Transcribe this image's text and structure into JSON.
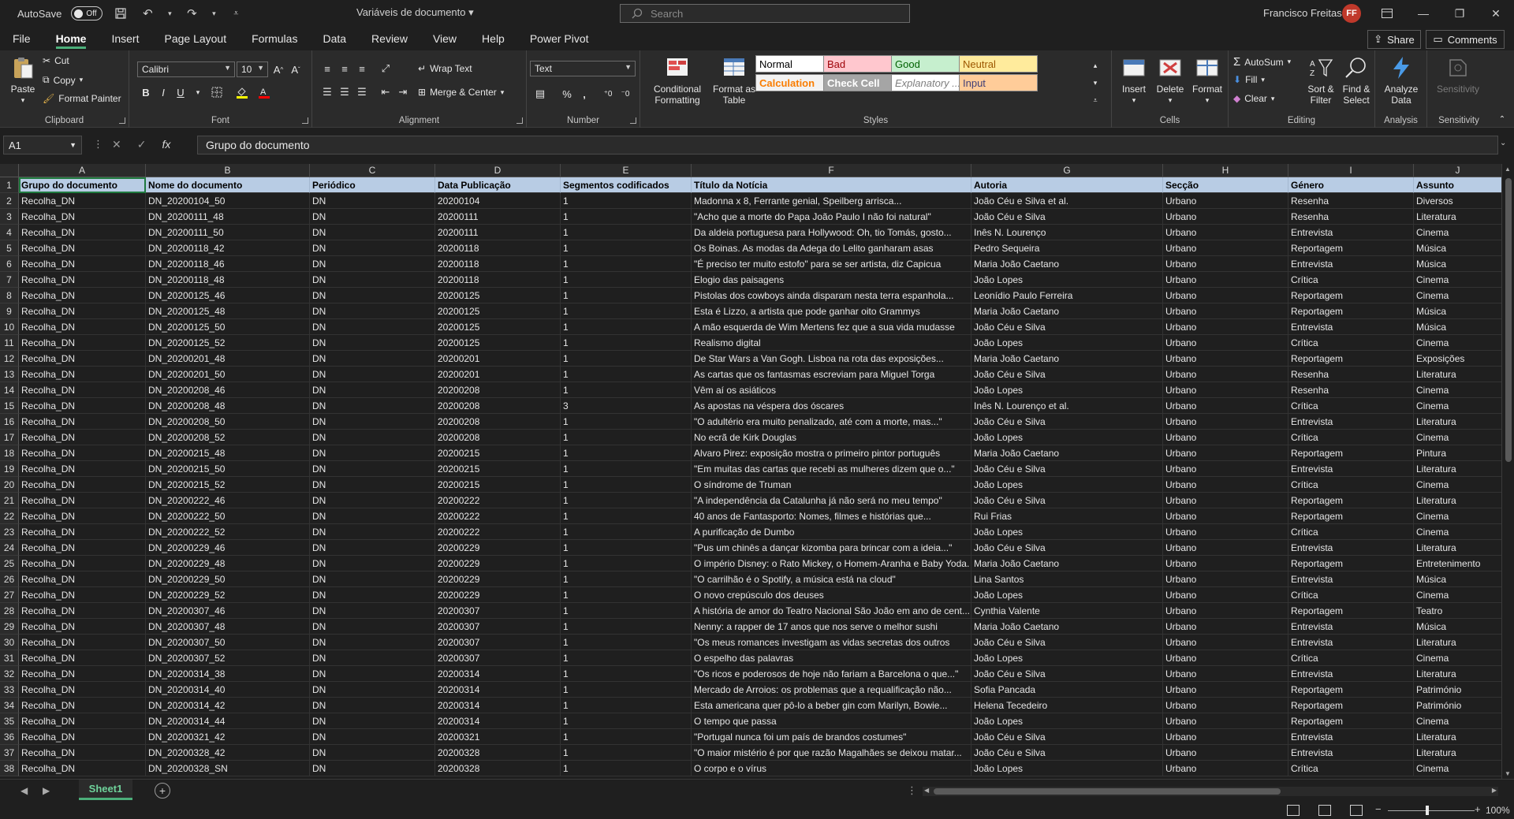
{
  "titlebar": {
    "autosave_label": "AutoSave",
    "autosave_state": "Off",
    "document_title": "Variáveis de documento",
    "search_placeholder": "Search",
    "user_name": "Francisco Freitas",
    "user_initials": "FF"
  },
  "menu": {
    "tabs": [
      "File",
      "Home",
      "Insert",
      "Page Layout",
      "Formulas",
      "Data",
      "Review",
      "View",
      "Help",
      "Power Pivot"
    ],
    "active": "Home",
    "share_label": "Share",
    "comments_label": "Comments"
  },
  "ribbon": {
    "clipboard": {
      "label": "Clipboard",
      "paste": "Paste",
      "cut": "Cut",
      "copy": "Copy",
      "format_painter": "Format Painter"
    },
    "font": {
      "label": "Font",
      "font_name": "Calibri",
      "font_size": "10",
      "bold": "B",
      "italic": "I",
      "underline": "U"
    },
    "alignment": {
      "label": "Alignment",
      "wrap_text": "Wrap Text",
      "merge_center": "Merge & Center"
    },
    "number": {
      "label": "Number",
      "format": "Text"
    },
    "styles": {
      "label": "Styles",
      "conditional_formatting": "Conditional Formatting",
      "format_as_table": "Format as Table",
      "cells": [
        {
          "name": "Normal",
          "bg": "#ffffff",
          "fg": "#000000"
        },
        {
          "name": "Bad",
          "bg": "#ffc7ce",
          "fg": "#9c0006"
        },
        {
          "name": "Good",
          "bg": "#c6efce",
          "fg": "#006100"
        },
        {
          "name": "Neutral",
          "bg": "#ffeb9c",
          "fg": "#9c5700"
        },
        {
          "name": "Calculation",
          "bg": "#f2f2f2",
          "fg": "#fa7d00"
        },
        {
          "name": "Check Cell",
          "bg": "#a5a5a5",
          "fg": "#ffffff"
        },
        {
          "name": "Explanatory ...",
          "bg": "#ffffff",
          "fg": "#7f7f7f"
        },
        {
          "name": "Input",
          "bg": "#ffcc99",
          "fg": "#3f3f76"
        }
      ]
    },
    "cells_group": {
      "label": "Cells",
      "insert": "Insert",
      "delete": "Delete",
      "format": "Format"
    },
    "editing": {
      "label": "Editing",
      "autosum": "AutoSum",
      "fill": "Fill",
      "clear": "Clear",
      "sort_filter": "Sort & Filter",
      "find_select": "Find & Select"
    },
    "analysis": {
      "label": "Analysis",
      "analyze_data": "Analyze Data"
    },
    "sensitivity": {
      "label": "Sensitivity",
      "sensitivity": "Sensitivity"
    }
  },
  "formula_bar": {
    "name_box": "A1",
    "value": "Grupo do documento"
  },
  "sheet": {
    "columns": [
      "A",
      "B",
      "C",
      "D",
      "E",
      "F",
      "G",
      "H",
      "I",
      "J"
    ],
    "header_row": [
      "Grupo do documento",
      "Nome do documento",
      "Periódico",
      "Data Publicação",
      "Segmentos codificados",
      "Título da Notícia",
      "Autoria",
      "Secção",
      "Género",
      "Assunto"
    ],
    "rows": [
      [
        "Recolha_DN",
        "DN_20200104_50",
        "DN",
        "20200104",
        "1",
        "Madonna x 8, Ferrante genial, Speilberg arrisca...",
        "João Céu e Silva et al.",
        "Urbano",
        "Resenha",
        "Diversos"
      ],
      [
        "Recolha_DN",
        "DN_20200111_48",
        "DN",
        "20200111",
        "1",
        "\"Acho que a morte do Papa João Paulo I não foi natural\"",
        "João Céu e Silva",
        "Urbano",
        "Resenha",
        "Literatura"
      ],
      [
        "Recolha_DN",
        "DN_20200111_50",
        "DN",
        "20200111",
        "1",
        "Da aldeia portuguesa para Hollywood: Oh, tio Tomás, gosto...",
        "Inês N. Lourenço",
        "Urbano",
        "Entrevista",
        "Cinema"
      ],
      [
        "Recolha_DN",
        "DN_20200118_42",
        "DN",
        "20200118",
        "1",
        "Os Boinas. As modas da Adega do Lelito ganharam asas",
        "Pedro Sequeira",
        "Urbano",
        "Reportagem",
        "Música"
      ],
      [
        "Recolha_DN",
        "DN_20200118_46",
        "DN",
        "20200118",
        "1",
        "\"É preciso ter muito estofo\" para se ser artista, diz Capicua",
        "Maria João Caetano",
        "Urbano",
        "Entrevista",
        "Música"
      ],
      [
        "Recolha_DN",
        "DN_20200118_48",
        "DN",
        "20200118",
        "1",
        "Elogio das paisagens",
        "João Lopes",
        "Urbano",
        "Crítica",
        "Cinema"
      ],
      [
        "Recolha_DN",
        "DN_20200125_46",
        "DN",
        "20200125",
        "1",
        "Pistolas dos cowboys ainda disparam nesta terra espanhola...",
        "Leonídio Paulo Ferreira",
        "Urbano",
        "Reportagem",
        "Cinema"
      ],
      [
        "Recolha_DN",
        "DN_20200125_48",
        "DN",
        "20200125",
        "1",
        "Esta é Lizzo, a artista que pode ganhar oito Grammys",
        "Maria João Caetano",
        "Urbano",
        "Reportagem",
        "Música"
      ],
      [
        "Recolha_DN",
        "DN_20200125_50",
        "DN",
        "20200125",
        "1",
        "A mão esquerda de Wim Mertens fez que a sua vida mudasse",
        "João Céu e Silva",
        "Urbano",
        "Entrevista",
        "Música"
      ],
      [
        "Recolha_DN",
        "DN_20200125_52",
        "DN",
        "20200125",
        "1",
        "Realismo digital",
        "João Lopes",
        "Urbano",
        "Crítica",
        "Cinema"
      ],
      [
        "Recolha_DN",
        "DN_20200201_48",
        "DN",
        "20200201",
        "1",
        "De Star Wars a Van Gogh. Lisboa na rota das exposições...",
        "Maria João Caetano",
        "Urbano",
        "Reportagem",
        "Exposições"
      ],
      [
        "Recolha_DN",
        "DN_20200201_50",
        "DN",
        "20200201",
        "1",
        "As cartas que os fantasmas escreviam para Miguel Torga",
        "João Céu e Silva",
        "Urbano",
        "Resenha",
        "Literatura"
      ],
      [
        "Recolha_DN",
        "DN_20200208_46",
        "DN",
        "20200208",
        "1",
        "Vêm aí os asiáticos",
        "João Lopes",
        "Urbano",
        "Resenha",
        "Cinema"
      ],
      [
        "Recolha_DN",
        "DN_20200208_48",
        "DN",
        "20200208",
        "3",
        "As apostas na véspera dos óscares",
        "Inês N. Lourenço et al.",
        "Urbano",
        "Crítica",
        "Cinema"
      ],
      [
        "Recolha_DN",
        "DN_20200208_50",
        "DN",
        "20200208",
        "1",
        "\"O adultério era muito penalizado, até com a morte, mas...\"",
        "João Céu e Silva",
        "Urbano",
        "Entrevista",
        "Literatura"
      ],
      [
        "Recolha_DN",
        "DN_20200208_52",
        "DN",
        "20200208",
        "1",
        "No ecrã de Kirk Douglas",
        "João Lopes",
        "Urbano",
        "Crítica",
        "Cinema"
      ],
      [
        "Recolha_DN",
        "DN_20200215_48",
        "DN",
        "20200215",
        "1",
        "Alvaro Pirez: exposição mostra o primeiro pintor português",
        "Maria João Caetano",
        "Urbano",
        "Reportagem",
        "Pintura"
      ],
      [
        "Recolha_DN",
        "DN_20200215_50",
        "DN",
        "20200215",
        "1",
        "\"Em muitas das cartas que recebi as mulheres dizem que o...\"",
        "João Céu e Silva",
        "Urbano",
        "Entrevista",
        "Literatura"
      ],
      [
        "Recolha_DN",
        "DN_20200215_52",
        "DN",
        "20200215",
        "1",
        "O síndrome de Truman",
        "João Lopes",
        "Urbano",
        "Crítica",
        "Cinema"
      ],
      [
        "Recolha_DN",
        "DN_20200222_46",
        "DN",
        "20200222",
        "1",
        "\"A independência da Catalunha já não será no meu tempo\"",
        "João Céu e Silva",
        "Urbano",
        "Reportagem",
        "Literatura"
      ],
      [
        "Recolha_DN",
        "DN_20200222_50",
        "DN",
        "20200222",
        "1",
        "40 anos de Fantasporto: Nomes, filmes e histórias que...",
        "Rui Frias",
        "Urbano",
        "Reportagem",
        "Cinema"
      ],
      [
        "Recolha_DN",
        "DN_20200222_52",
        "DN",
        "20200222",
        "1",
        "A purificação de Dumbo",
        "João Lopes",
        "Urbano",
        "Crítica",
        "Cinema"
      ],
      [
        "Recolha_DN",
        "DN_20200229_46",
        "DN",
        "20200229",
        "1",
        "\"Pus um chinês a dançar kizomba para brincar com a ideia...\"",
        "João Céu e Silva",
        "Urbano",
        "Entrevista",
        "Literatura"
      ],
      [
        "Recolha_DN",
        "DN_20200229_48",
        "DN",
        "20200229",
        "1",
        "O império Disney: o Rato Mickey, o Homem-Aranha e Baby Yoda.",
        "Maria João Caetano",
        "Urbano",
        "Reportagem",
        "Entretenimento"
      ],
      [
        "Recolha_DN",
        "DN_20200229_50",
        "DN",
        "20200229",
        "1",
        "\"O carrilhão é o Spotify, a música está na cloud\"",
        "Lina Santos",
        "Urbano",
        "Entrevista",
        "Música"
      ],
      [
        "Recolha_DN",
        "DN_20200229_52",
        "DN",
        "20200229",
        "1",
        "O novo crepúsculo dos deuses",
        "João Lopes",
        "Urbano",
        "Crítica",
        "Cinema"
      ],
      [
        "Recolha_DN",
        "DN_20200307_46",
        "DN",
        "20200307",
        "1",
        "A história de amor do Teatro Nacional São João em ano de cent...",
        "Cynthia Valente",
        "Urbano",
        "Reportagem",
        "Teatro"
      ],
      [
        "Recolha_DN",
        "DN_20200307_48",
        "DN",
        "20200307",
        "1",
        "Nenny: a rapper de 17 anos que nos serve o melhor sushi",
        "Maria João Caetano",
        "Urbano",
        "Entrevista",
        "Música"
      ],
      [
        "Recolha_DN",
        "DN_20200307_50",
        "DN",
        "20200307",
        "1",
        "\"Os meus romances investigam as vidas secretas dos outros",
        "João Céu e Silva",
        "Urbano",
        "Entrevista",
        "Literatura"
      ],
      [
        "Recolha_DN",
        "DN_20200307_52",
        "DN",
        "20200307",
        "1",
        "O espelho das palavras",
        "João Lopes",
        "Urbano",
        "Crítica",
        "Cinema"
      ],
      [
        "Recolha_DN",
        "DN_20200314_38",
        "DN",
        "20200314",
        "1",
        "\"Os ricos e poderosos de hoje não fariam a Barcelona o que...\"",
        "João Céu e Silva",
        "Urbano",
        "Entrevista",
        "Literatura"
      ],
      [
        "Recolha_DN",
        "DN_20200314_40",
        "DN",
        "20200314",
        "1",
        "Mercado de Arroios: os problemas que a requalificação não...",
        "Sofia Pancada",
        "Urbano",
        "Reportagem",
        "Património"
      ],
      [
        "Recolha_DN",
        "DN_20200314_42",
        "DN",
        "20200314",
        "1",
        "Esta americana quer pô-lo a beber gin com Marilyn, Bowie...",
        "Helena Tecedeiro",
        "Urbano",
        "Reportagem",
        "Património"
      ],
      [
        "Recolha_DN",
        "DN_20200314_44",
        "DN",
        "20200314",
        "1",
        "O tempo que passa",
        "João Lopes",
        "Urbano",
        "Reportagem",
        "Cinema"
      ],
      [
        "Recolha_DN",
        "DN_20200321_42",
        "DN",
        "20200321",
        "1",
        "\"Portugal nunca foi um país de brandos costumes\"",
        "João Céu e Silva",
        "Urbano",
        "Entrevista",
        "Literatura"
      ],
      [
        "Recolha_DN",
        "DN_20200328_42",
        "DN",
        "20200328",
        "1",
        "\"O maior mistério é por que razão Magalhães se deixou matar...",
        "João Céu e Silva",
        "Urbano",
        "Entrevista",
        "Literatura"
      ],
      [
        "Recolha_DN",
        "DN_20200328_SN",
        "DN",
        "20200328",
        "1",
        "O corpo e o vírus",
        "João Lopes",
        "Urbano",
        "Crítica",
        "Cinema"
      ]
    ]
  },
  "sheet_tabs": {
    "active": "Sheet1"
  },
  "status": {
    "zoom": "100%"
  },
  "colors": {
    "accent": "#4caf7a",
    "header_fill": "#b8cce4",
    "avatar": "#c0392b"
  }
}
